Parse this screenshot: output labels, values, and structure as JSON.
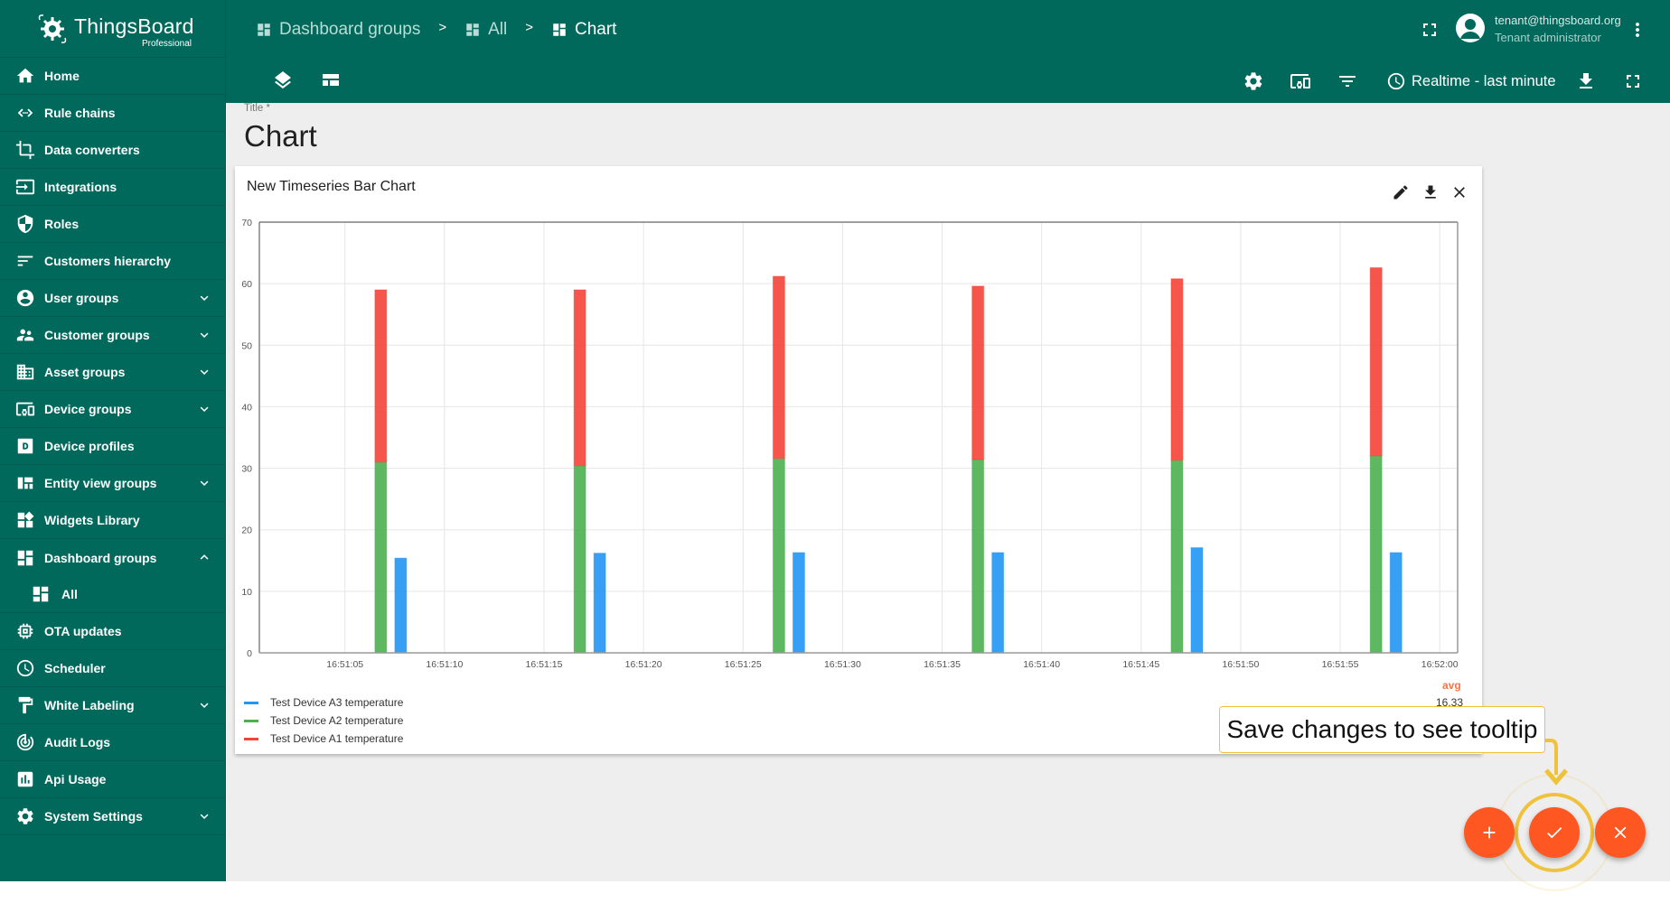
{
  "app": {
    "logo_title": "ThingsBoard",
    "logo_subtitle": "Professional",
    "brand_color": "#00695c",
    "accent_color": "#ff5722"
  },
  "sidebar": {
    "items": [
      {
        "label": "Home",
        "icon": "home-icon"
      },
      {
        "label": "Rule chains",
        "icon": "rule-chains-icon"
      },
      {
        "label": "Data converters",
        "icon": "data-converters-icon"
      },
      {
        "label": "Integrations",
        "icon": "integrations-icon"
      },
      {
        "label": "Roles",
        "icon": "shield-icon"
      },
      {
        "label": "Customers hierarchy",
        "icon": "hierarchy-icon"
      },
      {
        "label": "User groups",
        "icon": "account-circle-icon",
        "expandable": true
      },
      {
        "label": "Customer groups",
        "icon": "supervisor-account-icon",
        "expandable": true
      },
      {
        "label": "Asset groups",
        "icon": "domain-icon",
        "expandable": true
      },
      {
        "label": "Device groups",
        "icon": "devices-other-icon",
        "expandable": true
      },
      {
        "label": "Device profiles",
        "icon": "device-profile-icon"
      },
      {
        "label": "Entity view groups",
        "icon": "view-quilt-icon",
        "expandable": true
      },
      {
        "label": "Widgets Library",
        "icon": "widgets-icon"
      },
      {
        "label": "Dashboard groups",
        "icon": "dashboard-icon",
        "expandable": true,
        "expanded": true
      },
      {
        "label": "All",
        "icon": "dashboard-icon",
        "child": true
      },
      {
        "label": "OTA updates",
        "icon": "memory-icon"
      },
      {
        "label": "Scheduler",
        "icon": "schedule-icon"
      },
      {
        "label": "White Labeling",
        "icon": "format-paint-icon",
        "expandable": true
      },
      {
        "label": "Audit Logs",
        "icon": "track-changes-icon"
      },
      {
        "label": "Api Usage",
        "icon": "insert-chart-icon"
      },
      {
        "label": "System Settings",
        "icon": "settings-icon",
        "expandable": true
      }
    ]
  },
  "header": {
    "breadcrumbs": [
      {
        "label": "Dashboard groups",
        "icon": "dashboard-icon"
      },
      {
        "label": "All",
        "icon": "dashboard-icon"
      },
      {
        "label": "Chart",
        "icon": "dashboard-icon"
      }
    ],
    "breadcrumb_separator": ">",
    "user": {
      "email": "tenant@thingsboard.org",
      "role": "Tenant administrator"
    },
    "timewindow_label": "Realtime - last minute"
  },
  "editor": {
    "title_label": "Title *",
    "title_value": "Chart"
  },
  "widget": {
    "title": "New Timeseries Bar Chart",
    "legend": {
      "avg_header": "avg",
      "avg_values": [
        "16.33"
      ],
      "entries": [
        {
          "label": "Test Device A3 temperature",
          "color": "#2196f3"
        },
        {
          "label": "Test Device A2 temperature",
          "color": "#4caf50"
        },
        {
          "label": "Test Device A1 temperature",
          "color": "#f44336"
        }
      ]
    }
  },
  "tooltip": {
    "text": "Save changes to see tooltip",
    "border_color": "#f0c23c"
  },
  "chart_data": {
    "type": "bar",
    "title": "New Timeseries Bar Chart",
    "xlabel": "",
    "ylabel": "",
    "ylim": [
      0,
      70
    ],
    "yticks": [
      0,
      10,
      20,
      30,
      40,
      50,
      60,
      70
    ],
    "xlim_seconds": [
      0.7,
      60.9
    ],
    "xticks": [
      {
        "t": 5,
        "label": "16:51:05"
      },
      {
        "t": 10,
        "label": "16:51:10"
      },
      {
        "t": 15,
        "label": "16:51:15"
      },
      {
        "t": 20,
        "label": "16:51:20"
      },
      {
        "t": 25,
        "label": "16:51:25"
      },
      {
        "t": 30,
        "label": "16:51:30"
      },
      {
        "t": 35,
        "label": "16:51:35"
      },
      {
        "t": 40,
        "label": "16:51:40"
      },
      {
        "t": 45,
        "label": "16:51:45"
      },
      {
        "t": 50,
        "label": "16:51:50"
      },
      {
        "t": 55,
        "label": "16:51:55"
      },
      {
        "t": 60,
        "label": "16:52:00"
      }
    ],
    "time_base": "16:51:00",
    "grid": true,
    "stacked_series": [
      "Test Device A2 temperature",
      "Test Device A1 temperature"
    ],
    "series": [
      {
        "name": "Test Device A3 temperature",
        "color": "#2196f3",
        "t": [
          7.8,
          17.8,
          27.8,
          37.8,
          47.8,
          57.8
        ],
        "values": [
          15.4,
          16.2,
          16.3,
          16.3,
          17.1,
          16.3
        ]
      },
      {
        "name": "Test Device A2 temperature",
        "color": "#4caf50",
        "t": [
          6.8,
          16.8,
          26.8,
          36.8,
          46.8,
          56.8
        ],
        "values": [
          31.0,
          30.4,
          31.6,
          31.4,
          31.3,
          32.0
        ]
      },
      {
        "name": "Test Device A1 temperature",
        "color": "#f44336",
        "t": [
          6.8,
          16.8,
          26.8,
          36.8,
          46.8,
          56.8
        ],
        "values": [
          28.0,
          28.6,
          29.6,
          28.2,
          29.5,
          30.6
        ]
      }
    ],
    "legend": "bottom-left"
  }
}
